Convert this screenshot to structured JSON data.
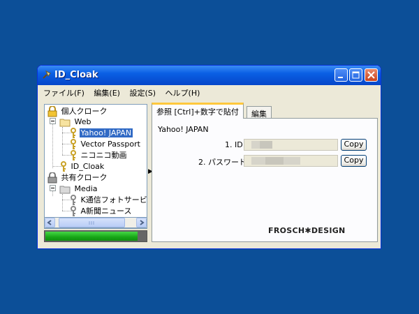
{
  "window": {
    "title": "ID_Cloak",
    "icon": "tool-icon"
  },
  "menu": [
    "ファイル(F)",
    "編集(E)",
    "設定(S)",
    "ヘルプ(H)"
  ],
  "tree": {
    "personal": "個人クローク",
    "web": "Web",
    "yahoo": "Yahoo! JAPAN",
    "vector": "Vector Passport",
    "nico": "ニコニコ動画",
    "idcloak": "ID_Cloak",
    "shared": "共有クローク",
    "media": "Media",
    "k": "K通信フォトサービ",
    "a": "A新聞ニュース",
    "selected": "Yahoo! JAPAN"
  },
  "tabs": {
    "reference": "参照 [Ctrl]+数字で貼付",
    "edit": "編集"
  },
  "detail": {
    "heading": "Yahoo! JAPAN",
    "id_label": "1. ID",
    "password_label": "2. パスワード",
    "copy": "Copy"
  },
  "progress": 0.92,
  "brand": "FROSCH✱DESIGN"
}
